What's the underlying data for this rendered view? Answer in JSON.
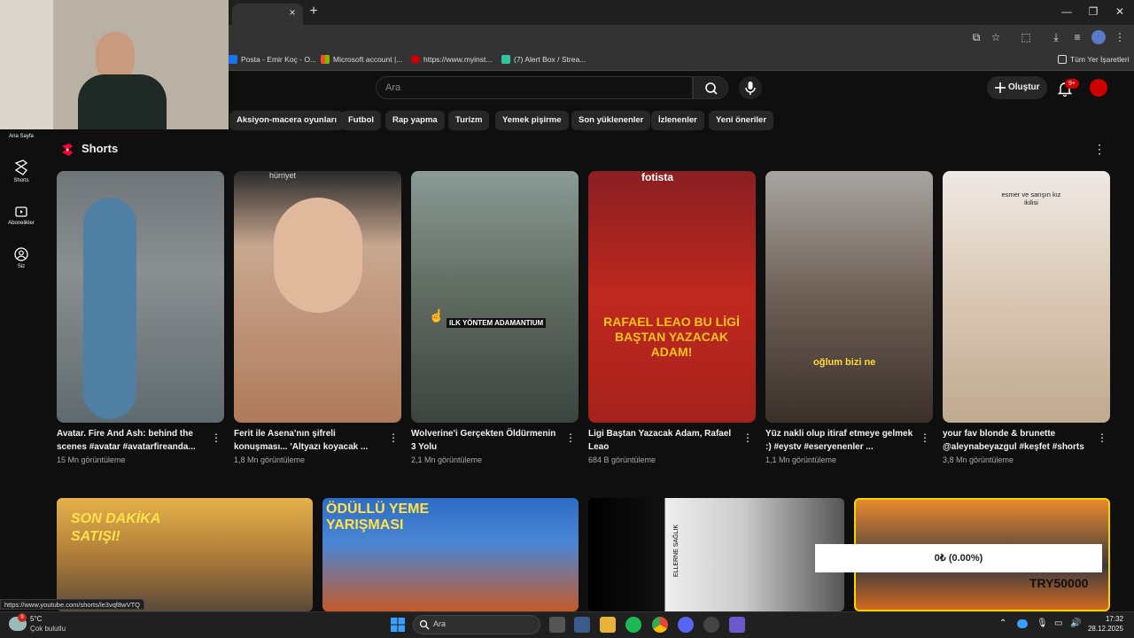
{
  "browser": {
    "tab_close": "×",
    "new_tab": "+",
    "bookmarks": [
      "Posta - Emir Koç - O...",
      "Microsoft account |...",
      "https://www.myinst...",
      "(7) Alert Box / Strea..."
    ],
    "all_bookmarks": "Tüm Yer İşaretleri"
  },
  "header": {
    "search_placeholder": "Ara",
    "create_label": "Oluştur",
    "notif_badge": "9+"
  },
  "chips": [
    "Aksiyon-macera oyunları",
    "Futbol",
    "Rap yapma",
    "Turizm",
    "Yemek pişirme",
    "Son yüklenenler",
    "İzlenenler",
    "Yeni öneriler"
  ],
  "sidebar": {
    "home": "Ana Sayfa",
    "shorts": "Shorts",
    "subscriptions": "Abonelikler",
    "you": "Siz"
  },
  "shorts": {
    "title": "Shorts",
    "items": [
      {
        "title": "Avatar. Fire And Ash: behind the scenes #avatar #avatarfireanda...",
        "views": "15 Mn görüntüleme",
        "overlay": ""
      },
      {
        "title": "Ferit ile Asena'nın şifreli konuşması... 'Altyazı koyacak ...",
        "views": "1,8 Mn görüntüleme",
        "overlay": "hürriyet"
      },
      {
        "title": "Wolverine'i Gerçekten Öldürmenin 3 Yolu",
        "views": "2,1 Mn görüntüleme",
        "overlay": "ILK YÖNTEM ADAMANTIUM"
      },
      {
        "title": "Ligi Baştan Yazacak Adam, Rafael Leao",
        "views": "684 B görüntüleme",
        "overlay": "RAFAEL LEAO BU LİGİ BAŞTAN YAZACAK ADAM!"
      },
      {
        "title": "Yüz nakli olup itiraf etmeye gelmek :) #eystv #eseryenenler ...",
        "views": "1,1 Mn görüntüleme",
        "overlay": "oğlum bizi ne"
      },
      {
        "title": "your fav blonde & brunette @aleynabeyazgul #keşfet #shorts",
        "views": "3,8 Mn görüntüleme",
        "overlay": "esmer ve sarışın kız ikilisi"
      }
    ]
  },
  "videos": {
    "thumb1_text": "SON DAKİKA SATIŞI!",
    "thumb2_text": "ÖDÜLLÜ YEME YARIŞMASI",
    "thumb3_text": "ELLERNE SAĞLIK",
    "thumb4_text": "TRY50000"
  },
  "overlay_text": "0₺ (0.00%)",
  "status_url": "https://www.youtube.com/shorts/le3vqf8wVTQ",
  "taskbar": {
    "weather_temp": "5°C",
    "weather_desc": "Çok bulutlu",
    "weather_badge": "9",
    "search": "Ara",
    "time": "17:32",
    "date": "28.12.2025"
  },
  "colors": {
    "bg": "#0f0f0f",
    "accent": "#ff0033",
    "chip": "#272727"
  }
}
